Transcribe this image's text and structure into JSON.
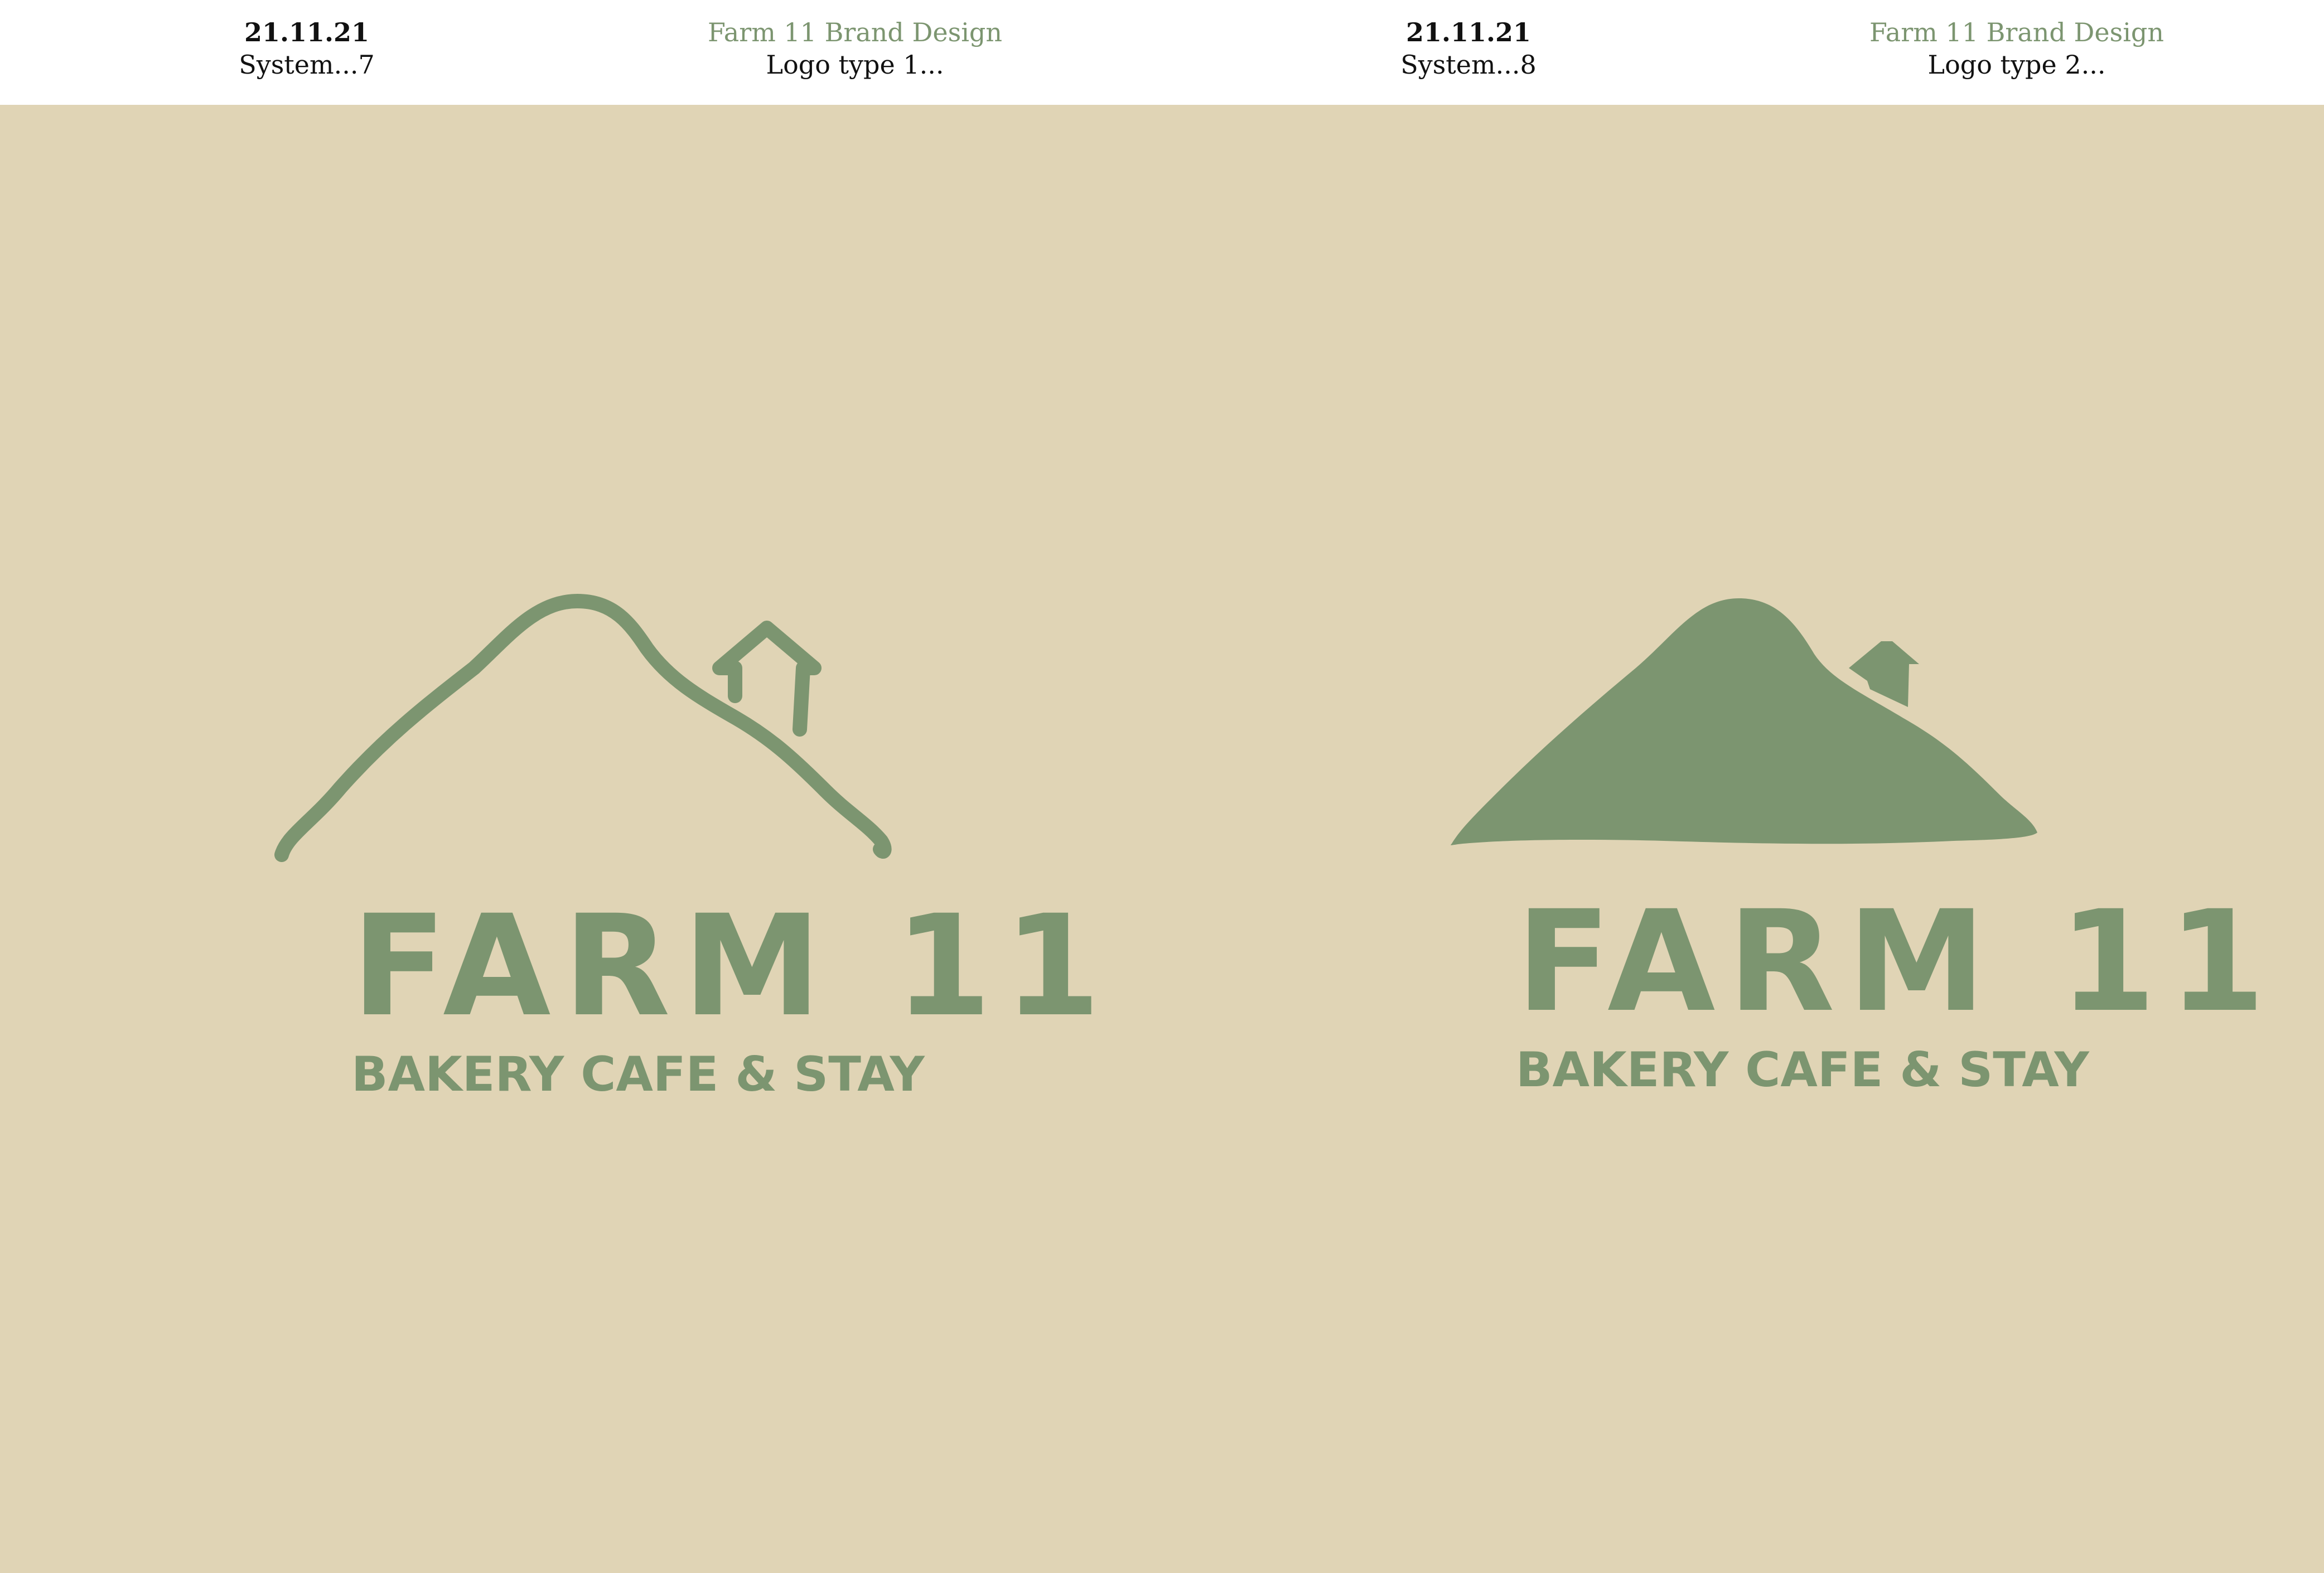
{
  "header": {
    "cells": [
      {
        "line1": "21.11.21",
        "line2": "System...7"
      },
      {
        "line1": "Farm 11 Brand Design",
        "line2": "Logo type 1..."
      },
      {
        "line1": "21.11.21",
        "line2": "System...8"
      },
      {
        "line1": "Farm 11 Brand Design",
        "line2": "Logo type 2..."
      }
    ]
  },
  "logos": [
    {
      "style": "outline",
      "title": "FARM 11",
      "subtitle": "BAKERY CAFE & STAY"
    },
    {
      "style": "filled",
      "title": "FARM 11",
      "subtitle": "BAKERY CAFE & STAY"
    }
  ],
  "colors": {
    "background": "#e0d4b5",
    "header_background": "#ffffff",
    "brand_green": "#7c9570",
    "text_dark": "#111111"
  }
}
